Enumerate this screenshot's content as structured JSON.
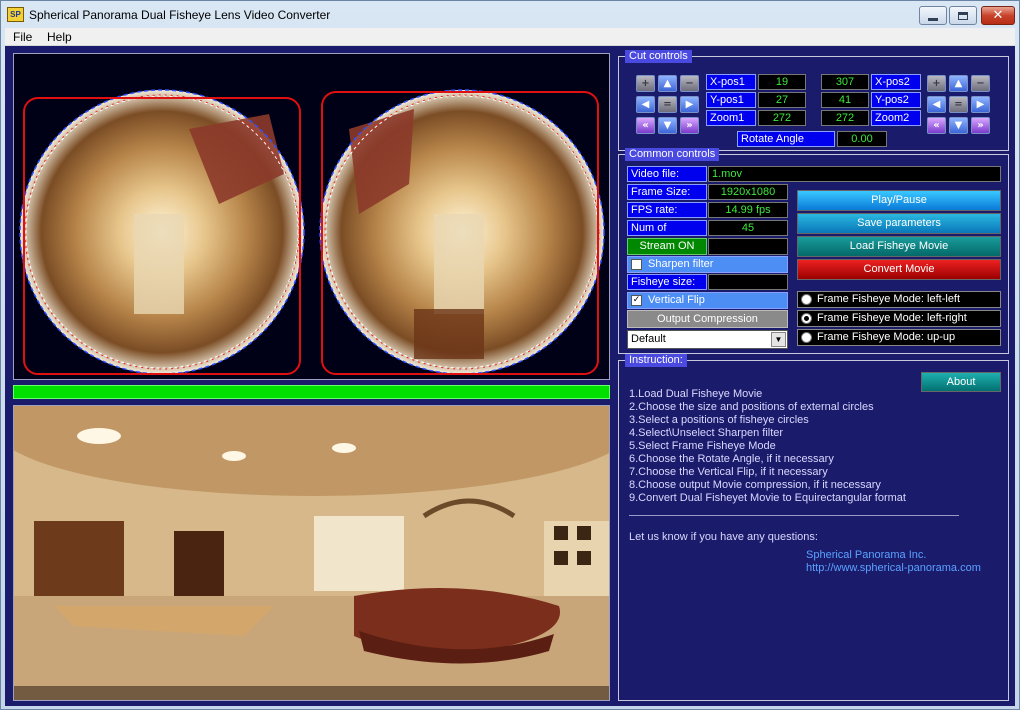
{
  "window": {
    "title": "Spherical Panorama Dual Fisheye Lens Video Converter",
    "icon_label": "SP"
  },
  "menu": [
    "File",
    "Help"
  ],
  "cut_controls": {
    "label": "Cut controls",
    "left": {
      "xpos_label": "X-pos1",
      "xpos": "19",
      "ypos_label": "Y-pos1",
      "ypos": "27",
      "zoom_label": "Zoom1",
      "zoom": "272"
    },
    "right": {
      "xpos_label": "X-pos2",
      "xpos": "307",
      "ypos_label": "Y-pos2",
      "ypos": "41",
      "zoom_label": "Zoom2",
      "zoom": "272"
    },
    "rotate_label": "Rotate Angle",
    "rotate_value": "0.00"
  },
  "common_controls": {
    "label": "Common controls",
    "video_file_label": "Video file:",
    "video_file": "1.mov",
    "frame_size_label": "Frame Size:",
    "frame_size": "1920x1080",
    "fps_label": "FPS rate:",
    "fps": "14.99 fps",
    "frames_label": "Num of frames:",
    "frames": "45",
    "stream_label": "Stream ON",
    "sharpen_label": "Sharpen filter",
    "sharpen_checked": false,
    "fisheye_size_label": "Fisheye size:",
    "vflip_label": "Vertical Flip",
    "vflip_checked": true,
    "output_compression_label": "Output Compression",
    "compression_value": "Default",
    "buttons": {
      "play": "Play/Pause",
      "save": "Save parameters",
      "load": "Load Fisheye Movie",
      "convert": "Convert Movie"
    },
    "modes": [
      "Frame Fisheye Mode: left-left",
      "Frame Fisheye Mode: left-right",
      "Frame Fisheye Mode: up-up"
    ],
    "selected_mode": 1
  },
  "instruction": {
    "label": "Instruction:",
    "about": "About",
    "steps": [
      "1.Load Dual Fisheye Movie",
      "2.Choose the size and positions of external circles",
      "3.Select a positions of fisheye circles",
      "4.Select\\Unselect Sharpen filter",
      "5.Select Frame Fisheye Mode",
      "6.Choose the Rotate Angle, if it necessary",
      "7.Choose the Vertical Flip, if it necessary",
      "8.Choose output Movie compression, if it necessary",
      "9.Convert Dual Fisheyet Movie to Equirectangular format"
    ],
    "contact_text": "Let us know if you have any questions:",
    "company": "Spherical Panorama Inc.",
    "url": "http://www.spherical-panorama.com"
  },
  "colors": {
    "client_bg": "#1b1b6c",
    "label_bg": "#0000ee",
    "value_text": "#3ee83e",
    "progress": "#00e000"
  }
}
